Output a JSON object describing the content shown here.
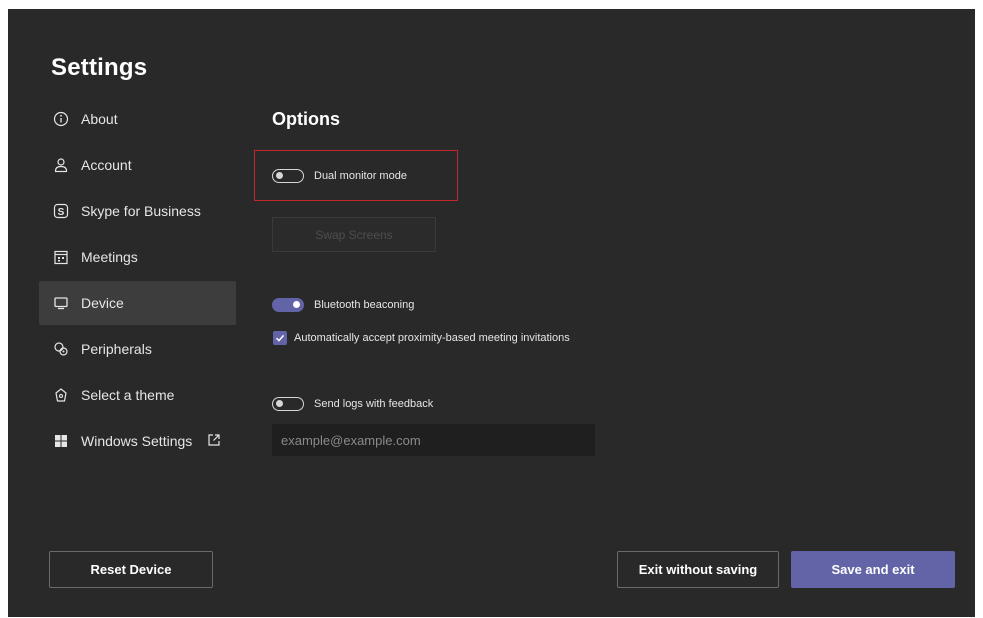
{
  "page": {
    "title": "Settings"
  },
  "nav": {
    "items": [
      {
        "label": "About",
        "icon": "info-icon"
      },
      {
        "label": "Account",
        "icon": "person-icon"
      },
      {
        "label": "Skype for Business",
        "icon": "skype-icon"
      },
      {
        "label": "Meetings",
        "icon": "calendar-icon"
      },
      {
        "label": "Device",
        "icon": "monitor-icon",
        "active": true
      },
      {
        "label": "Peripherals",
        "icon": "peripherals-icon"
      },
      {
        "label": "Select a theme",
        "icon": "theme-icon"
      },
      {
        "label": "Windows Settings",
        "icon": "windows-icon",
        "trailing_icon": "external-link-icon"
      }
    ]
  },
  "options": {
    "title": "Options",
    "dual_monitor": {
      "label": "Dual monitor mode",
      "on": false
    },
    "swap_screens_label": "Swap Screens",
    "bluetooth": {
      "label": "Bluetooth beaconing",
      "on": true
    },
    "auto_accept": {
      "label": "Automatically accept proximity-based meeting invitations",
      "checked": true
    },
    "send_logs": {
      "label": "Send logs with feedback",
      "on": false
    },
    "email": {
      "placeholder": "example@example.com",
      "value": ""
    }
  },
  "footer": {
    "reset_label": "Reset Device",
    "exit_label": "Exit without saving",
    "save_label": "Save and exit"
  },
  "colors": {
    "panel_bg": "#292929",
    "accent": "#6264a7",
    "highlight_border": "#c4262e"
  }
}
